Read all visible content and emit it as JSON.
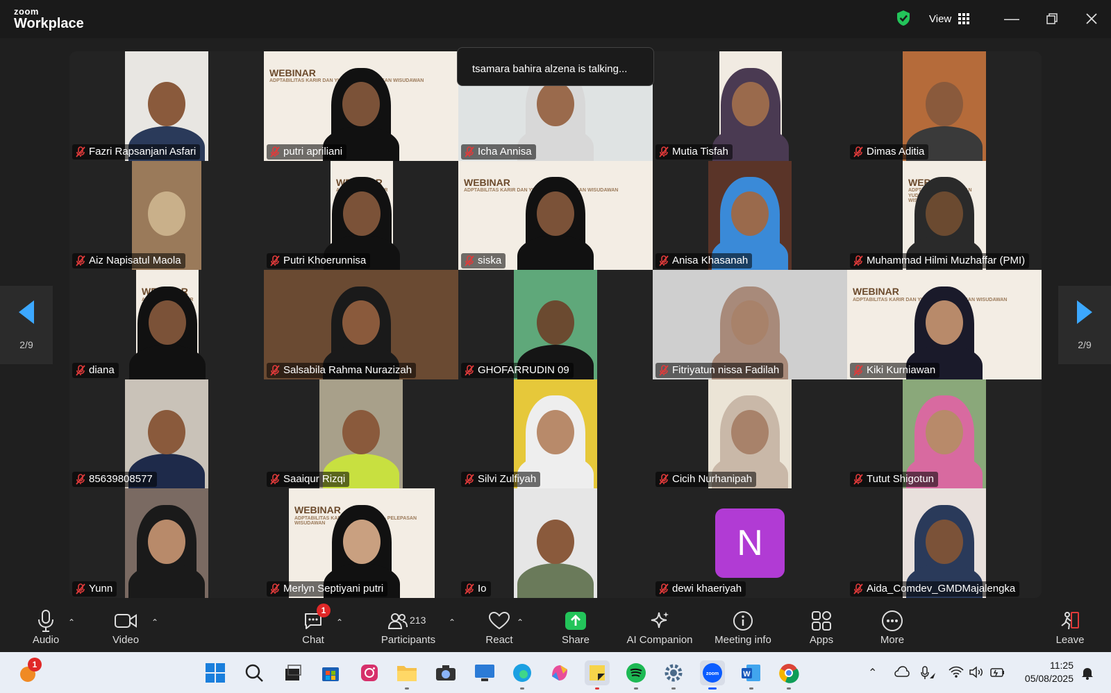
{
  "app": {
    "logo_small": "zoom",
    "logo_big": "Workplace",
    "view_label": "View"
  },
  "talking_banner": "tsamara bahira alzena is talking...",
  "page_indicator": {
    "left": "2/9",
    "right": "2/9"
  },
  "participants": [
    {
      "name": "Fazri Rapsanjani Asfari",
      "kind": "cam",
      "bg": "#e8e6e2",
      "skin": "#8a5a3c",
      "cloth": "#2a3a5a",
      "vx": 80,
      "vw": 120
    },
    {
      "name": "putri apriliani",
      "kind": "webinar",
      "bg": "#f3ede4",
      "skin": "#7b5238",
      "cloth": "#111111",
      "vx": 0,
      "vw": 280
    },
    {
      "name": "Icha Annisa",
      "kind": "hijab",
      "bg": "#dfe3e3",
      "skin": "#9a6a4c",
      "cloth": "#d8d8d8",
      "vx": 0,
      "vw": 280
    },
    {
      "name": "Mutia Tisfah",
      "kind": "hijab",
      "bg": "#f1ebe2",
      "skin": "#9a6a4c",
      "cloth": "#4a3a52",
      "vx": 96,
      "vw": 90
    },
    {
      "name": "Dimas Aditia",
      "kind": "cam",
      "bg": "#b56b3a",
      "skin": "#8a5a3c",
      "cloth": "#3a3a3a",
      "vx": 80,
      "vw": 120
    },
    {
      "name": "Aiz Napisatul Maola",
      "kind": "photo",
      "bg": "#9a7a5a",
      "skin": "#c9b08a",
      "cloth": "#333333",
      "vx": 90,
      "vw": 100
    },
    {
      "name": "Putri Khoerunnisa",
      "kind": "webinar",
      "bg": "#f3ede4",
      "skin": "#7b5238",
      "cloth": "#111111",
      "vx": 96,
      "vw": 90
    },
    {
      "name": "siska",
      "kind": "webinar",
      "bg": "#f3ede4",
      "skin": "#7b5238",
      "cloth": "#111111",
      "vx": 0,
      "vw": 280
    },
    {
      "name": "Anisa Khasanah",
      "kind": "hijab",
      "bg": "#5a3428",
      "skin": "#9a6a4c",
      "cloth": "#3a8ad8",
      "vx": 80,
      "vw": 120
    },
    {
      "name": "Muhammad Hilmi Muzhaffar (PMI)",
      "kind": "webinar",
      "bg": "#f3ede4",
      "skin": "#6b4a30",
      "cloth": "#2a2a2a",
      "vx": 80,
      "vw": 120
    },
    {
      "name": "diana",
      "kind": "webinar",
      "bg": "#f3ede4",
      "skin": "#7b5238",
      "cloth": "#111111",
      "vx": 96,
      "vw": 90
    },
    {
      "name": "Salsabila Rahma Nurazizah",
      "kind": "hijab",
      "bg": "#6a4a32",
      "skin": "#8a5a3c",
      "cloth": "#1a1a1a",
      "vx": 0,
      "vw": 280
    },
    {
      "name": "GHOFARRUDIN 09",
      "kind": "cam",
      "bg": "#5fa87a",
      "skin": "#6b4a30",
      "cloth": "#151515",
      "vx": 80,
      "vw": 120
    },
    {
      "name": "Fitriyatun nissa Fadilah",
      "kind": "hijab",
      "bg": "#cfcfcf",
      "skin": "#a8826a",
      "cloth": "#a88a7a",
      "vx": 0,
      "vw": 280
    },
    {
      "name": "Kiki Kurniawan",
      "kind": "webinar",
      "bg": "#f3ede4",
      "skin": "#b88a6a",
      "cloth": "#1a1a2a",
      "vx": 0,
      "vw": 280
    },
    {
      "name": "85639808577",
      "kind": "cam",
      "bg": "#c9c2b8",
      "skin": "#8a5a3c",
      "cloth": "#1e2a4a",
      "vx": 80,
      "vw": 120
    },
    {
      "name": "Saaiqur Rizqi",
      "kind": "cam",
      "bg": "#a8a08a",
      "skin": "#8a5a3c",
      "cloth": "#c8e040",
      "vx": 80,
      "vw": 120
    },
    {
      "name": "Silvi Zulfiyah",
      "kind": "hijab",
      "bg": "#e6c83a",
      "skin": "#b88a6a",
      "cloth": "#eeeeee",
      "vx": 80,
      "vw": 120
    },
    {
      "name": "Cicih Nurhanipah",
      "kind": "hijab",
      "bg": "#ebe4d6",
      "skin": "#a8826a",
      "cloth": "#c9b8a8",
      "vx": 80,
      "vw": 120
    },
    {
      "name": "Tutut Shigotun",
      "kind": "hijab",
      "bg": "#8aa87a",
      "skin": "#b88a6a",
      "cloth": "#d86aa0",
      "vx": 80,
      "vw": 120
    },
    {
      "name": "Yunn",
      "kind": "hijab",
      "bg": "#7a6a62",
      "skin": "#b88a6a",
      "cloth": "#1a1a1a",
      "vx": 80,
      "vw": 120
    },
    {
      "name": "Merlyn Septiyani putri",
      "kind": "webinar",
      "bg": "#f3ede4",
      "skin": "#c9a080",
      "cloth": "#111111",
      "vx": 36,
      "vw": 210
    },
    {
      "name": "Io",
      "kind": "cam",
      "bg": "#e6e6e6",
      "skin": "#8a5a3c",
      "cloth": "#6a7a5a",
      "vx": 80,
      "vw": 120
    },
    {
      "name": "dewi khaeriyah",
      "kind": "avatar",
      "bg": "#232323",
      "skin": "#232323",
      "cloth": "#232323",
      "vx": 0,
      "vw": 280,
      "initial": "N"
    },
    {
      "name": "Aida_Comdev_GMDMajalengka",
      "kind": "hijab",
      "bg": "#e8e0dc",
      "skin": "#7b5238",
      "cloth": "#2a3a5a",
      "vx": 80,
      "vw": 120
    }
  ],
  "webinar_banner": {
    "title": "WEBINAR",
    "subtitle": "ADPTABILITAS KARIR DAN YUDISIUM - PELEPASAN WISUDAWAN"
  },
  "toolbar": {
    "audio": "Audio",
    "video": "Video",
    "chat": "Chat",
    "chat_badge": "1",
    "participants": "Participants",
    "participants_count": "213",
    "react": "React",
    "share": "Share",
    "ai": "AI Companion",
    "meeting_info": "Meeting info",
    "apps": "Apps",
    "more": "More",
    "leave": "Leave"
  },
  "taskbar": {
    "time": "11:25",
    "date": "05/08/2025",
    "notif_badge": "1"
  },
  "colors": {
    "accent": "#3ca8ff",
    "share_green": "#23c45a",
    "mute_red": "#e03a3a",
    "avatar_purple": "#b13bd4"
  }
}
